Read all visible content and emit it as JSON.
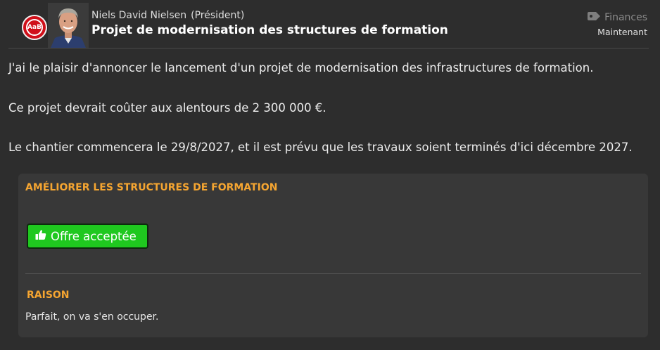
{
  "header": {
    "sender_name": "Niels David Nielsen",
    "sender_role": "(Président)",
    "subject": "Projet de modernisation des structures de formation",
    "category": "Finances",
    "time": "Maintenant",
    "club_logo_text": "AaB"
  },
  "message": {
    "paragraphs": [
      "J'ai le plaisir d'annoncer le lancement d'un projet de modernisation des infrastructures de formation.",
      "Ce projet devrait coûter aux alentours de 2 300 000 €.",
      "Le chantier commencera le 29/8/2027, et il est prévu que les travaux soient terminés d'ici décembre 2027."
    ]
  },
  "panel": {
    "title": "AMÉLIORER LES STRUCTURES DE FORMATION",
    "button_label": "Offre acceptée",
    "reason_title": "RAISON",
    "reason_text": "Parfait, on va s'en occuper."
  },
  "icons": {
    "category_icon": "tag-icon",
    "button_icon": "thumbs-up-icon"
  },
  "colors": {
    "background": "#2d2d2d",
    "panel": "#383838",
    "accent_orange": "#f5a531",
    "accept_green": "#1fc81f"
  }
}
